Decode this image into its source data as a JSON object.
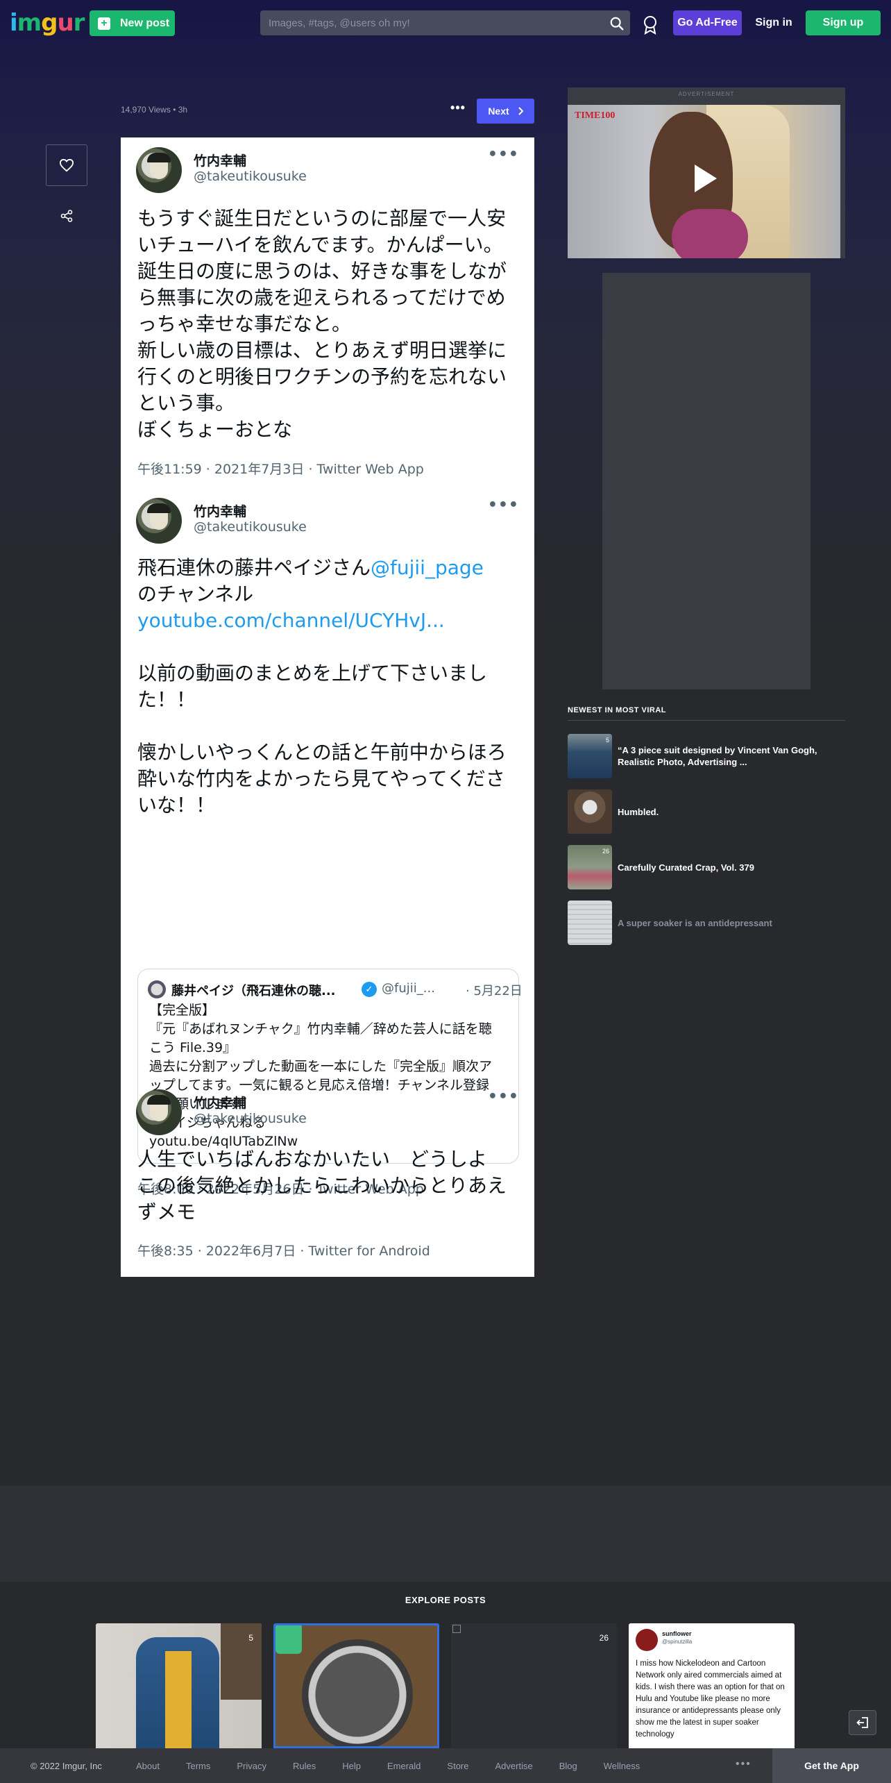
{
  "header": {
    "logo": "imgur",
    "new_post_label": "New post",
    "search_placeholder": "Images, #tags, @users oh my!",
    "go_ad_free_label": "Go Ad-Free",
    "sign_in_label": "Sign in",
    "sign_up_label": "Sign up"
  },
  "post": {
    "views": "14,970 Views",
    "separator": "•",
    "age": "3h",
    "next_label": "Next"
  },
  "tweets": [
    {
      "name": "竹内幸輔",
      "handle": "@takeutikousuke",
      "lines": [
        "もうすぐ誕生日だというのに部屋で一人安",
        "いチューハイを飲んでます。かんぱーい。",
        "誕生日の度に思うのは、好きな事をしなが",
        "ら無事に次の歳を迎えられるってだけでめ",
        "っちゃ幸せな事だなと。",
        "新しい歳の目標は、とりあえず明日選挙に",
        "行くのと明後日ワクチンの予約を忘れない",
        "という事。",
        "ぼくちょーおとな"
      ],
      "timestamp": "午後11:59 · 2021年7月3日 · Twitter Web App"
    },
    {
      "name": "竹内幸輔",
      "handle": "@takeutikousuke",
      "line1_text": "飛石連休の藤井ペイジさん",
      "line1_link": "@fujii_page",
      "line2": "のチャンネル",
      "link_url": "youtube.com/channel/UCYHvJ...",
      "lines_after": [
        "以前の動画のまとめを上げて下さいまし",
        "た！！",
        "",
        "懐かしいやっくんとの話と午前中からほろ",
        "酔いな竹内をよかったら見てやってくださ",
        "いな！！"
      ],
      "quote": {
        "name": "藤井ペイジ（飛石連休の聴...",
        "verified": "✓",
        "handle": "@fujii_...",
        "date": "· 5月22日",
        "lines": [
          "【完全版】",
          "『元『あばれヌンチャク』竹内幸輔／辞めた芸人に話を聴",
          "こう File.39』",
          "過去に分割アップした動画を一本にした『完全版』順次ア",
          "ップしてます。一気に観ると見応え倍増！チャンネル登録",
          "もお願いします！",
          "#ペイジちゃんねる",
          "youtu.be/4qlUTabZlNw"
        ]
      },
      "timestamp": "午後8:00 · 2022年5月26日 · Twitter Web App"
    },
    {
      "name": "竹内幸輔",
      "handle": "@takeutikousuke",
      "lines": [
        "人生でいちばんおなかいたい　どうしよ",
        "この後気絶とかしたらこわいからとりあえ",
        "ずメモ"
      ],
      "timestamp": "午後8:35 · 2022年6月7日 · Twitter for Android"
    }
  ],
  "sidebar": {
    "ad_label": "ADVERTISEMENT",
    "ad_brand": "TIME100",
    "viral_heading": "NEWEST IN MOST VIRAL",
    "viral_items": [
      {
        "title": "“A 3 piece suit designed by Vincent Van Gogh, Realistic Photo, Advertising ...",
        "count": "5"
      },
      {
        "title": "Humbled.",
        "count": ""
      },
      {
        "title": "Carefully Curated Crap, Vol. 379",
        "count": "26"
      },
      {
        "title": "A super soaker is an antidepressant",
        "count": ""
      }
    ]
  },
  "explore": {
    "heading": "EXPLORE POSTS",
    "cards": [
      {
        "count": "5"
      },
      {
        "count": ""
      },
      {
        "count": "26"
      },
      {
        "tweet_name": "sunflower",
        "tweet_handle": "@spinutzilla",
        "tweet_text": "I miss how Nickelodeon and Cartoon Network only aired commercials aimed at kids. I wish there was an option for that on Hulu and Youtube like please no more insurance or antidepressants please only show me the latest in super soaker technology"
      }
    ]
  },
  "footer": {
    "copyright": "© 2022 Imgur, Inc",
    "links": [
      "About",
      "Terms",
      "Privacy",
      "Rules",
      "Help",
      "Emerald",
      "Store",
      "Advertise",
      "Blog",
      "Wellness"
    ],
    "more": "•••",
    "get_app_label": "Get the App"
  },
  "colors": {
    "brand_green": "#1bb76e",
    "ad_free_purple": "#5c3fd9",
    "next_blue": "#4d57f2",
    "twitter_link": "#1d9bf0"
  }
}
